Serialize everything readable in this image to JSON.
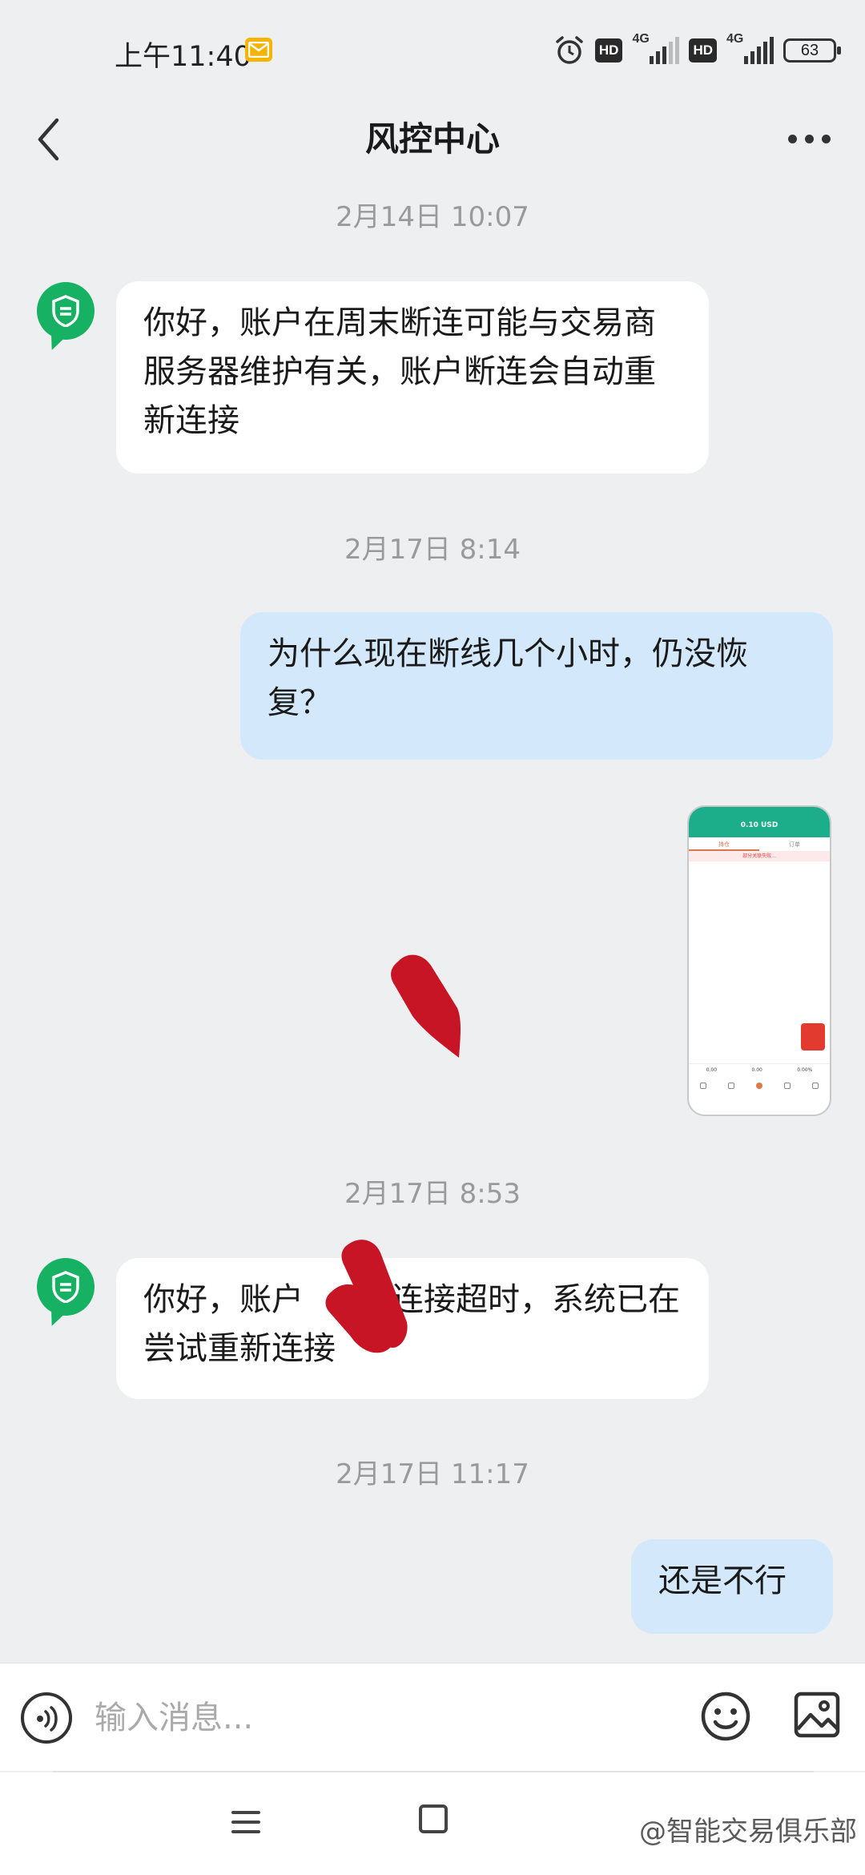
{
  "status_bar": {
    "time": "上午11:40",
    "network_1": "4G",
    "network_2": "4G",
    "hd_1": "HD",
    "hd_2": "HD",
    "battery": "63"
  },
  "header": {
    "title": "风控中心"
  },
  "messages": [
    {
      "type": "timestamp",
      "text": "2月14日 10:07"
    },
    {
      "type": "received",
      "text": "你好，账户在周末断连可能与交易商服务器维护有关，账户断连会自动重新连接"
    },
    {
      "type": "timestamp",
      "text": "2月17日 8:14"
    },
    {
      "type": "sent",
      "text": "为什么现在断线几个小时，仍没恢复？"
    },
    {
      "type": "sent_image",
      "thumbnail_title": "0.10 USD",
      "thumbnail_tab_1": "持仓",
      "thumbnail_tab_2": "订单",
      "thumbnail_warning": "部分关联失败...",
      "thumbnail_stats": [
        "0.00",
        "0.00",
        "0.00%"
      ]
    },
    {
      "type": "timestamp",
      "text": "2月17日 8:53"
    },
    {
      "type": "received",
      "text_part_1": "你好，账户",
      "text_part_2": "连接超时，系统已在尝试重新连接"
    },
    {
      "type": "timestamp",
      "text": "2月17日 11:17"
    },
    {
      "type": "sent",
      "text": "还是不行"
    }
  ],
  "input": {
    "placeholder": "输入消息..."
  },
  "watermark": "@智能交易俱乐部",
  "colors": {
    "background": "#eeeff1",
    "received_bubble": "#ffffff",
    "sent_bubble": "#d4e8fb",
    "avatar_green": "#17b163",
    "redaction_red": "#c81525"
  },
  "icons": [
    "back-arrow-icon",
    "more-dots-icon",
    "shield-icon",
    "voice-icon",
    "emoji-icon",
    "image-icon",
    "menu-icon",
    "home-icon",
    "alarm-icon",
    "mail-icon"
  ]
}
